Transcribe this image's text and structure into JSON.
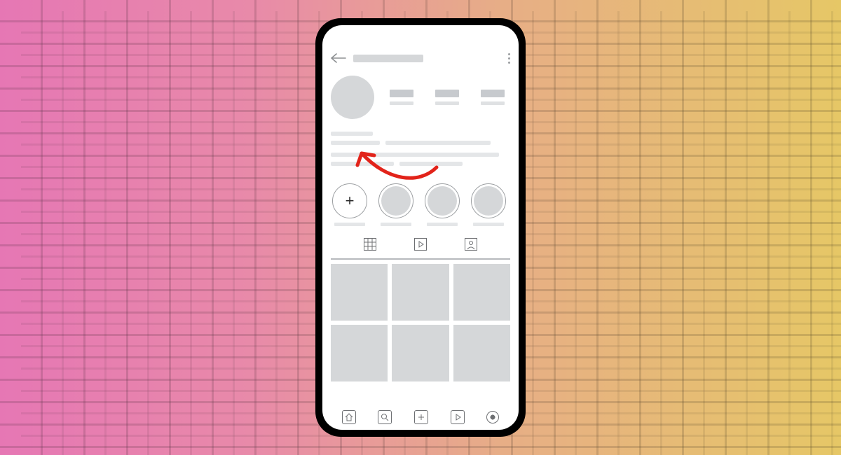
{
  "annotation": {
    "color": "#e2231a"
  },
  "topbar": {
    "back_icon": "back-arrow",
    "menu_icon": "kebab-menu"
  },
  "profile": {
    "avatar_placeholder": "avatar",
    "stats": [
      {
        "id": "posts"
      },
      {
        "id": "followers"
      },
      {
        "id": "following"
      }
    ]
  },
  "highlights": [
    {
      "id": "new",
      "type": "add",
      "glyph": "+"
    },
    {
      "id": "hl1",
      "type": "placeholder"
    },
    {
      "id": "hl2",
      "type": "placeholder"
    },
    {
      "id": "hl3",
      "type": "placeholder"
    }
  ],
  "feed_tabs": [
    {
      "id": "grid",
      "icon": "grid-icon"
    },
    {
      "id": "reels",
      "icon": "play-icon"
    },
    {
      "id": "tagged",
      "icon": "person-icon"
    }
  ],
  "post_grid": {
    "rows": 2,
    "cols": 3
  },
  "bottom_nav": [
    {
      "id": "home",
      "icon": "home-icon"
    },
    {
      "id": "search",
      "icon": "search-icon"
    },
    {
      "id": "create",
      "icon": "plus-icon"
    },
    {
      "id": "reels",
      "icon": "play-icon"
    },
    {
      "id": "profile",
      "icon": "profile-dot-icon"
    }
  ]
}
